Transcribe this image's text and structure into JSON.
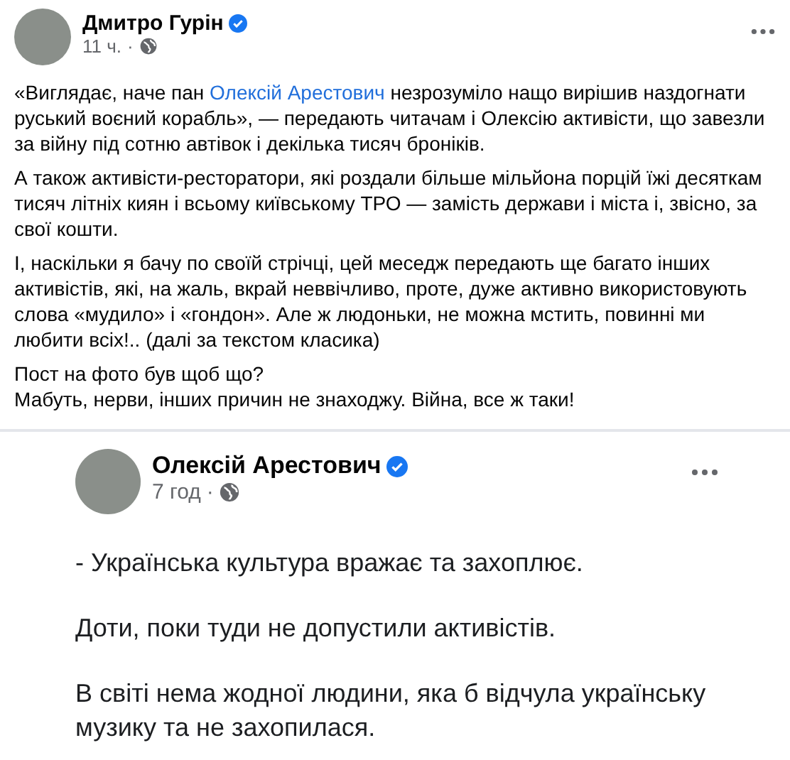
{
  "post": {
    "author": "Дмитро Гурін",
    "verified": true,
    "time": "11 ч.",
    "separator": "·",
    "paragraphs": [
      {
        "lines": [
          {
            "before": "«Виглядає, наче пан ",
            "link": "Олексій Арестович",
            "after": " незрозуміло нащо вирішив наздогнати руський воєний корабль», — передають читачам і Олексію активісти, що завезли за війну під сотню автівок і декілька тисяч броніків."
          }
        ]
      },
      {
        "lines": [
          {
            "before": "А також активісти-ресторатори, які роздали більше мільйона порцій їжі десяткам тисяч літніх киян і всьому київському ТРО — замість держави і міста і, звісно, за свої кошти."
          }
        ]
      },
      {
        "lines": [
          {
            "before": "І, наскільки я бачу по своїй стрічці, цей меседж передають ще багато інших активістів, які, на жаль, вкрай неввічливо, проте, дуже активно використовують слова «мудило» і «гондон». Але ж людоньки, не можна мстить, повинні ми любити всіх!.. (далі за текстом класика)"
          }
        ]
      },
      {
        "lines": [
          {
            "before": "Пост на фото був щоб що?"
          },
          {
            "before": "Мабуть, нерви, інших причин не знаходжу. Війна, все ж таки!"
          }
        ]
      }
    ],
    "embedded": {
      "author": "Олексій Арестович",
      "verified": true,
      "time": "7 год",
      "separator": "·",
      "paragraphs": [
        "- Українська культура вражає та захоплює.",
        "Доти, поки туди не допустили активістів.",
        "В світі нема жодної людини, яка б відчула українську музику та не захопилася."
      ]
    }
  }
}
